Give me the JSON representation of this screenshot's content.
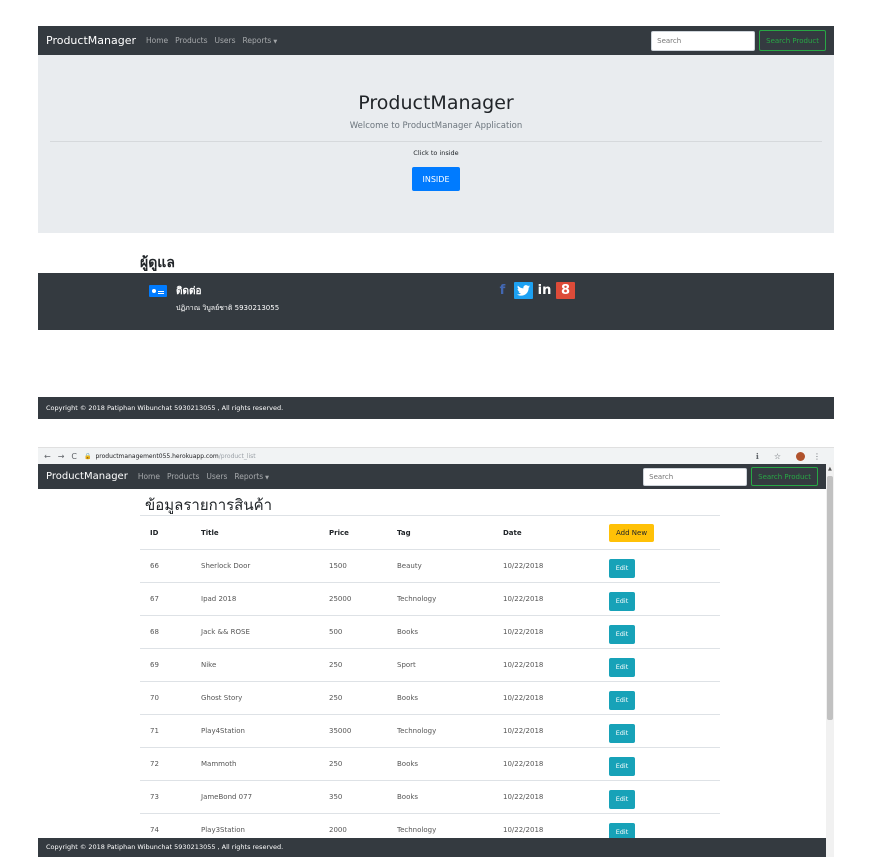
{
  "top": {
    "navbar": {
      "brand": "ProductManager",
      "links": [
        "Home",
        "Products",
        "Users",
        "Reports"
      ],
      "search_placeholder": "Search",
      "search_button": "Search Product"
    },
    "jumbotron": {
      "title": "ProductManager",
      "lead": "Welcome to ProductManager Application",
      "click_text": "Click to inside",
      "button": "INSIDE"
    },
    "admin_heading": "ผู้ดูแล",
    "contact": {
      "icon": "contact-card-icon",
      "title": "ติดต่อ",
      "name": "ปฏิภาณ วิบูลย์ชาติ 5930213055"
    },
    "social": {
      "facebook": "f",
      "twitter": "t",
      "linkedin": "in",
      "google": "8"
    },
    "copyright": "Copyright © 2018 Patiphan Wibunchat 5930213055 , All rights reserved."
  },
  "browser": {
    "url_host": "productmanagement055.herokuapp.com",
    "url_path": "/product_list"
  },
  "bottom": {
    "navbar": {
      "brand": "ProductManager",
      "links": [
        "Home",
        "Products",
        "Users",
        "Reports"
      ],
      "search_placeholder": "Search",
      "search_button": "Search Product"
    },
    "list_title": "ข้อมูลรายการสินค้า",
    "table": {
      "headers": [
        "ID",
        "Title",
        "Price",
        "Tag",
        "Date"
      ],
      "add_button": "Add New",
      "edit_label": "Edit",
      "rows": [
        {
          "id": "66",
          "title": "Sherlock Door",
          "price": "1500",
          "tag": "Beauty",
          "date": "10/22/2018"
        },
        {
          "id": "67",
          "title": "Ipad 2018",
          "price": "25000",
          "tag": "Technology",
          "date": "10/22/2018"
        },
        {
          "id": "68",
          "title": "Jack && ROSE",
          "price": "500",
          "tag": "Books",
          "date": "10/22/2018"
        },
        {
          "id": "69",
          "title": "Nike",
          "price": "250",
          "tag": "Sport",
          "date": "10/22/2018"
        },
        {
          "id": "70",
          "title": "Ghost Story",
          "price": "250",
          "tag": "Books",
          "date": "10/22/2018"
        },
        {
          "id": "71",
          "title": "Play4Station",
          "price": "35000",
          "tag": "Technology",
          "date": "10/22/2018"
        },
        {
          "id": "72",
          "title": "Mammoth",
          "price": "250",
          "tag": "Books",
          "date": "10/22/2018"
        },
        {
          "id": "73",
          "title": "JameBond 077",
          "price": "350",
          "tag": "Books",
          "date": "10/22/2018"
        },
        {
          "id": "74",
          "title": "Play3Station",
          "price": "2000",
          "tag": "Technology",
          "date": "10/22/2018"
        }
      ]
    },
    "copyright": "Copyright © 2018 Patiphan Wibunchat 5930213055 , All rights reserved."
  },
  "colors": {
    "navbar": "#343a40",
    "jumbotron": "#e9ecef",
    "primary": "#007bff",
    "success": "#28a745",
    "warning": "#ffc107",
    "info": "#17a2b8"
  }
}
